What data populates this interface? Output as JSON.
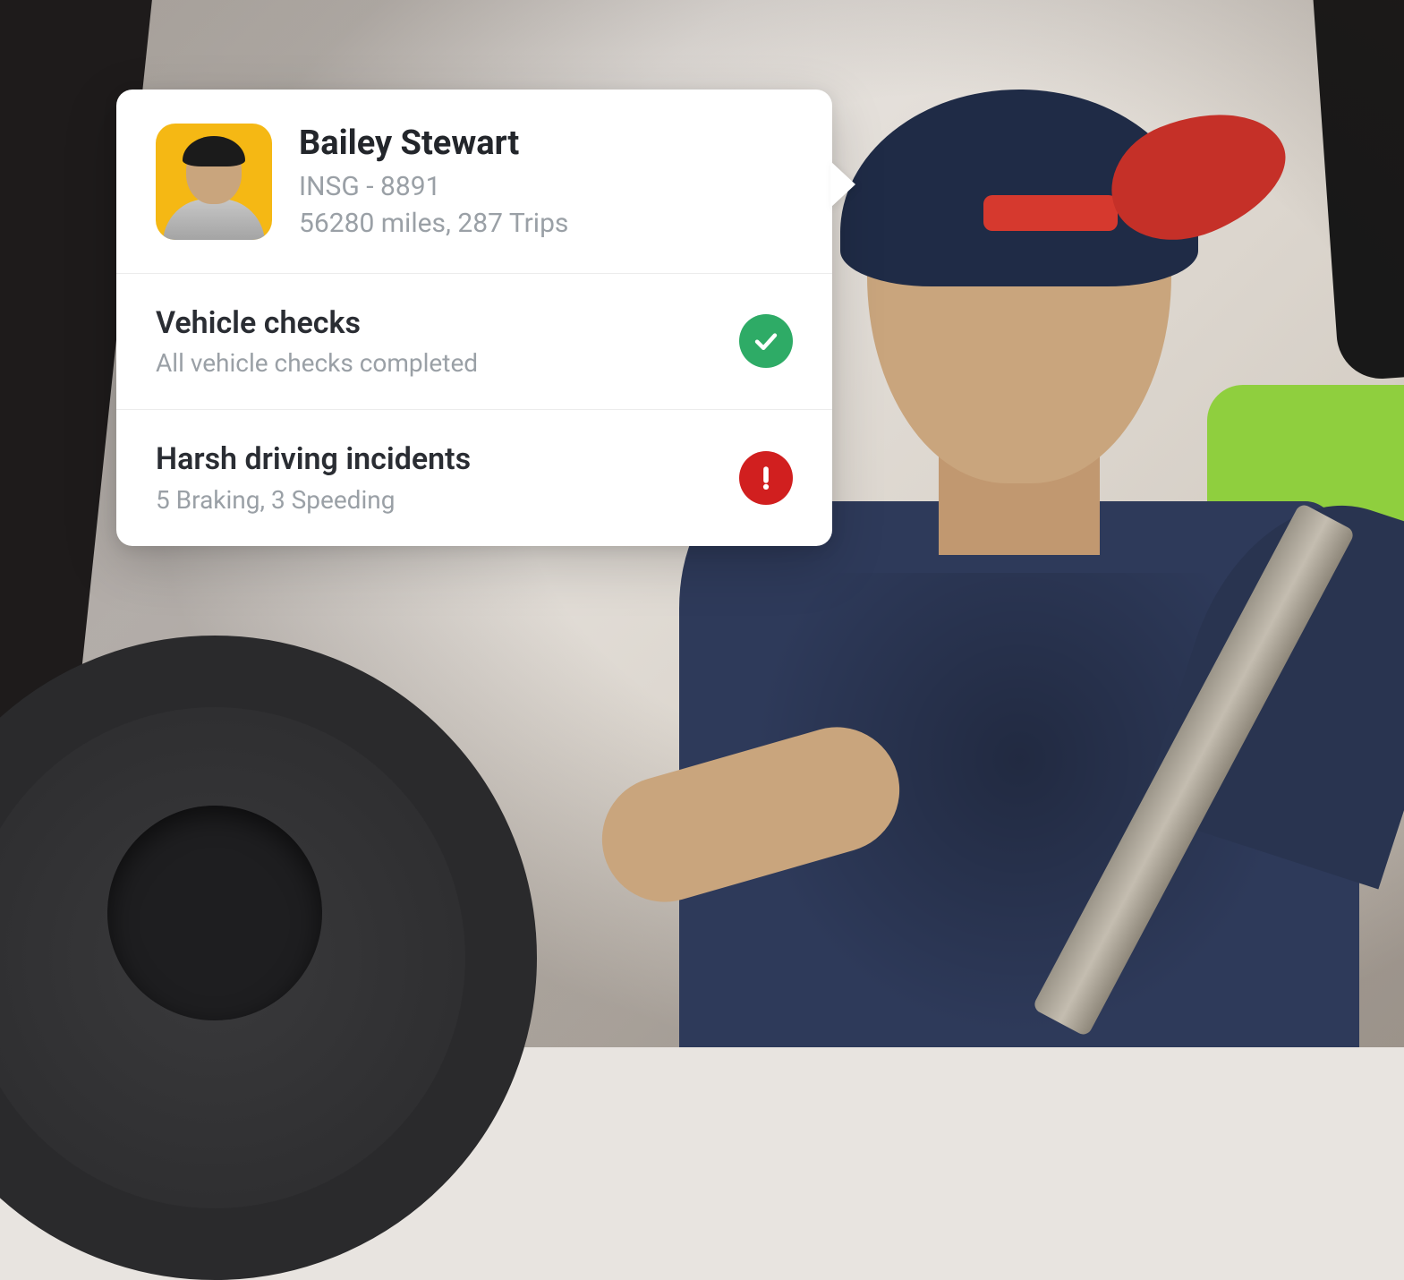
{
  "driver": {
    "name": "Bailey Stewart",
    "id": "INSG - 8891",
    "stats": "56280 miles, 287 Trips"
  },
  "rows": [
    {
      "title": "Vehicle checks",
      "subtitle": "All vehicle checks completed",
      "status": "success"
    },
    {
      "title": "Harsh driving incidents",
      "subtitle": "5 Braking, 3 Speeding",
      "status": "danger"
    }
  ],
  "colors": {
    "success": "#2eab66",
    "danger": "#d11f1f",
    "avatar_bg": "#f5b814"
  }
}
